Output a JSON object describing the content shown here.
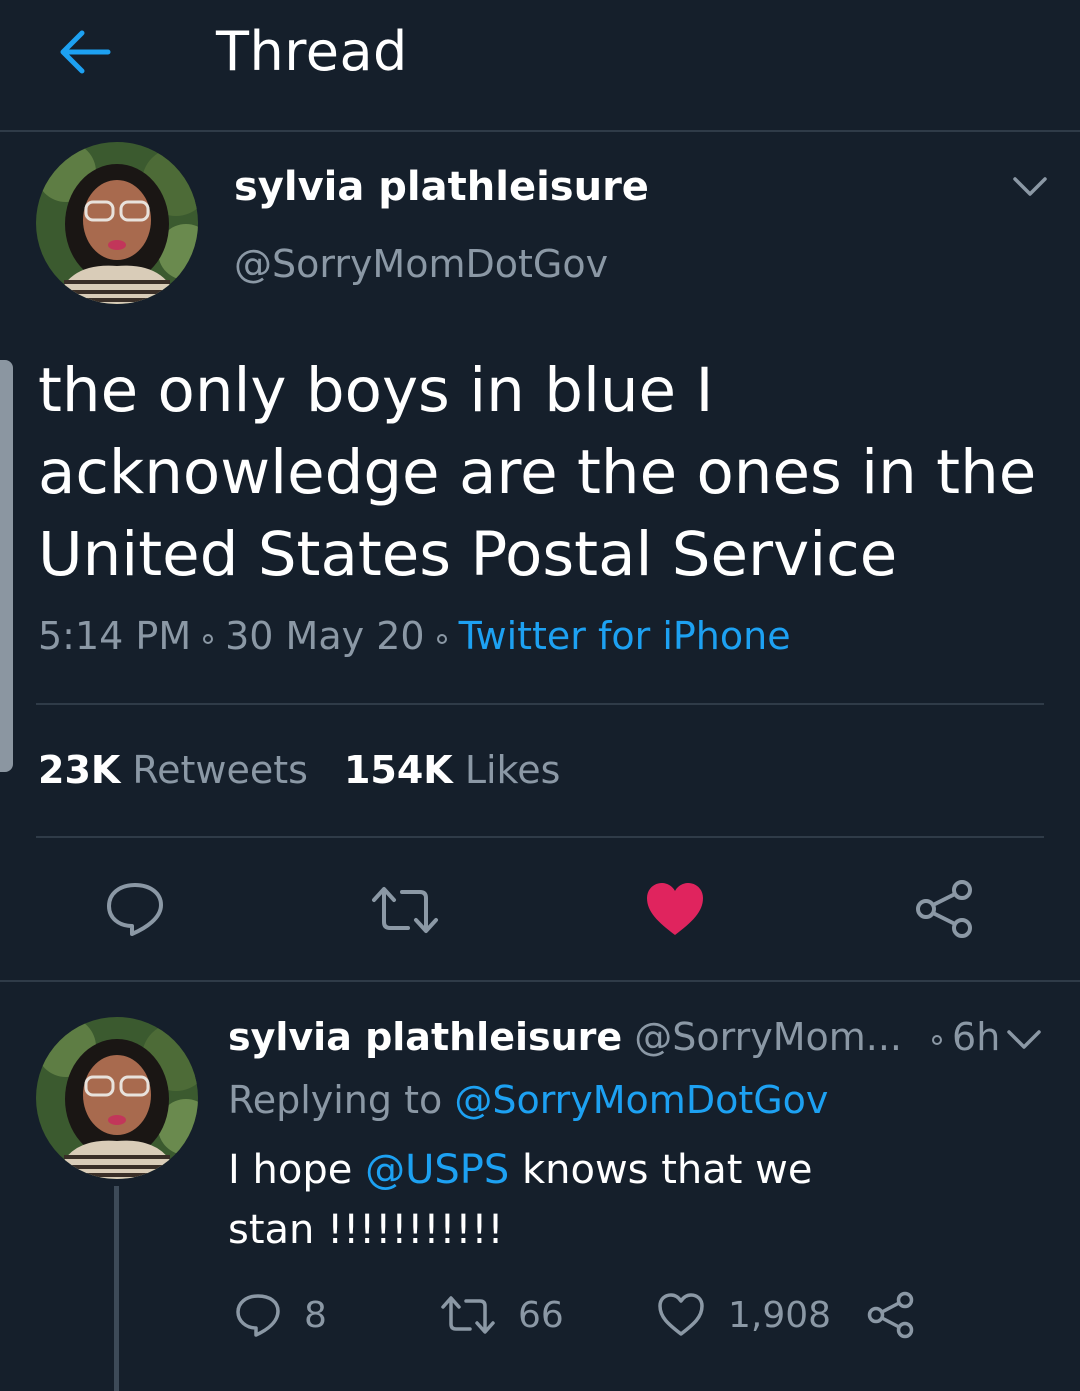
{
  "header": {
    "title": "Thread",
    "back_icon": "arrow-left-icon"
  },
  "tweet": {
    "author_name": "sylvia plathleisure",
    "author_handle": "@SorryMomDotGov",
    "text": "the only boys in blue I acknowledge are the ones in the United States Postal Service",
    "time": "5:14 PM",
    "date": "30 May 20",
    "source": "Twitter for iPhone",
    "retweets_count": "23K",
    "retweets_label": "Retweets",
    "likes_count": "154K",
    "likes_label": "Likes",
    "liked": true
  },
  "reply": {
    "author_name": "sylvia plathleisure",
    "author_handle": "@SorryMom...",
    "age": "6h",
    "replying_label": "Replying to",
    "replying_to": "@SorryMomDotGov",
    "text_before": "I hope",
    "mention": "@USPS",
    "text_after": "knows that we stan !!!!!!!!!!!",
    "replies_count": "8",
    "retweets_count": "66",
    "likes_count": "1,908"
  },
  "colors": {
    "background": "#151f2b",
    "accent": "#1da1f2",
    "like": "#e0245e",
    "muted": "#8b98a5",
    "divider": "#2f3b48"
  }
}
